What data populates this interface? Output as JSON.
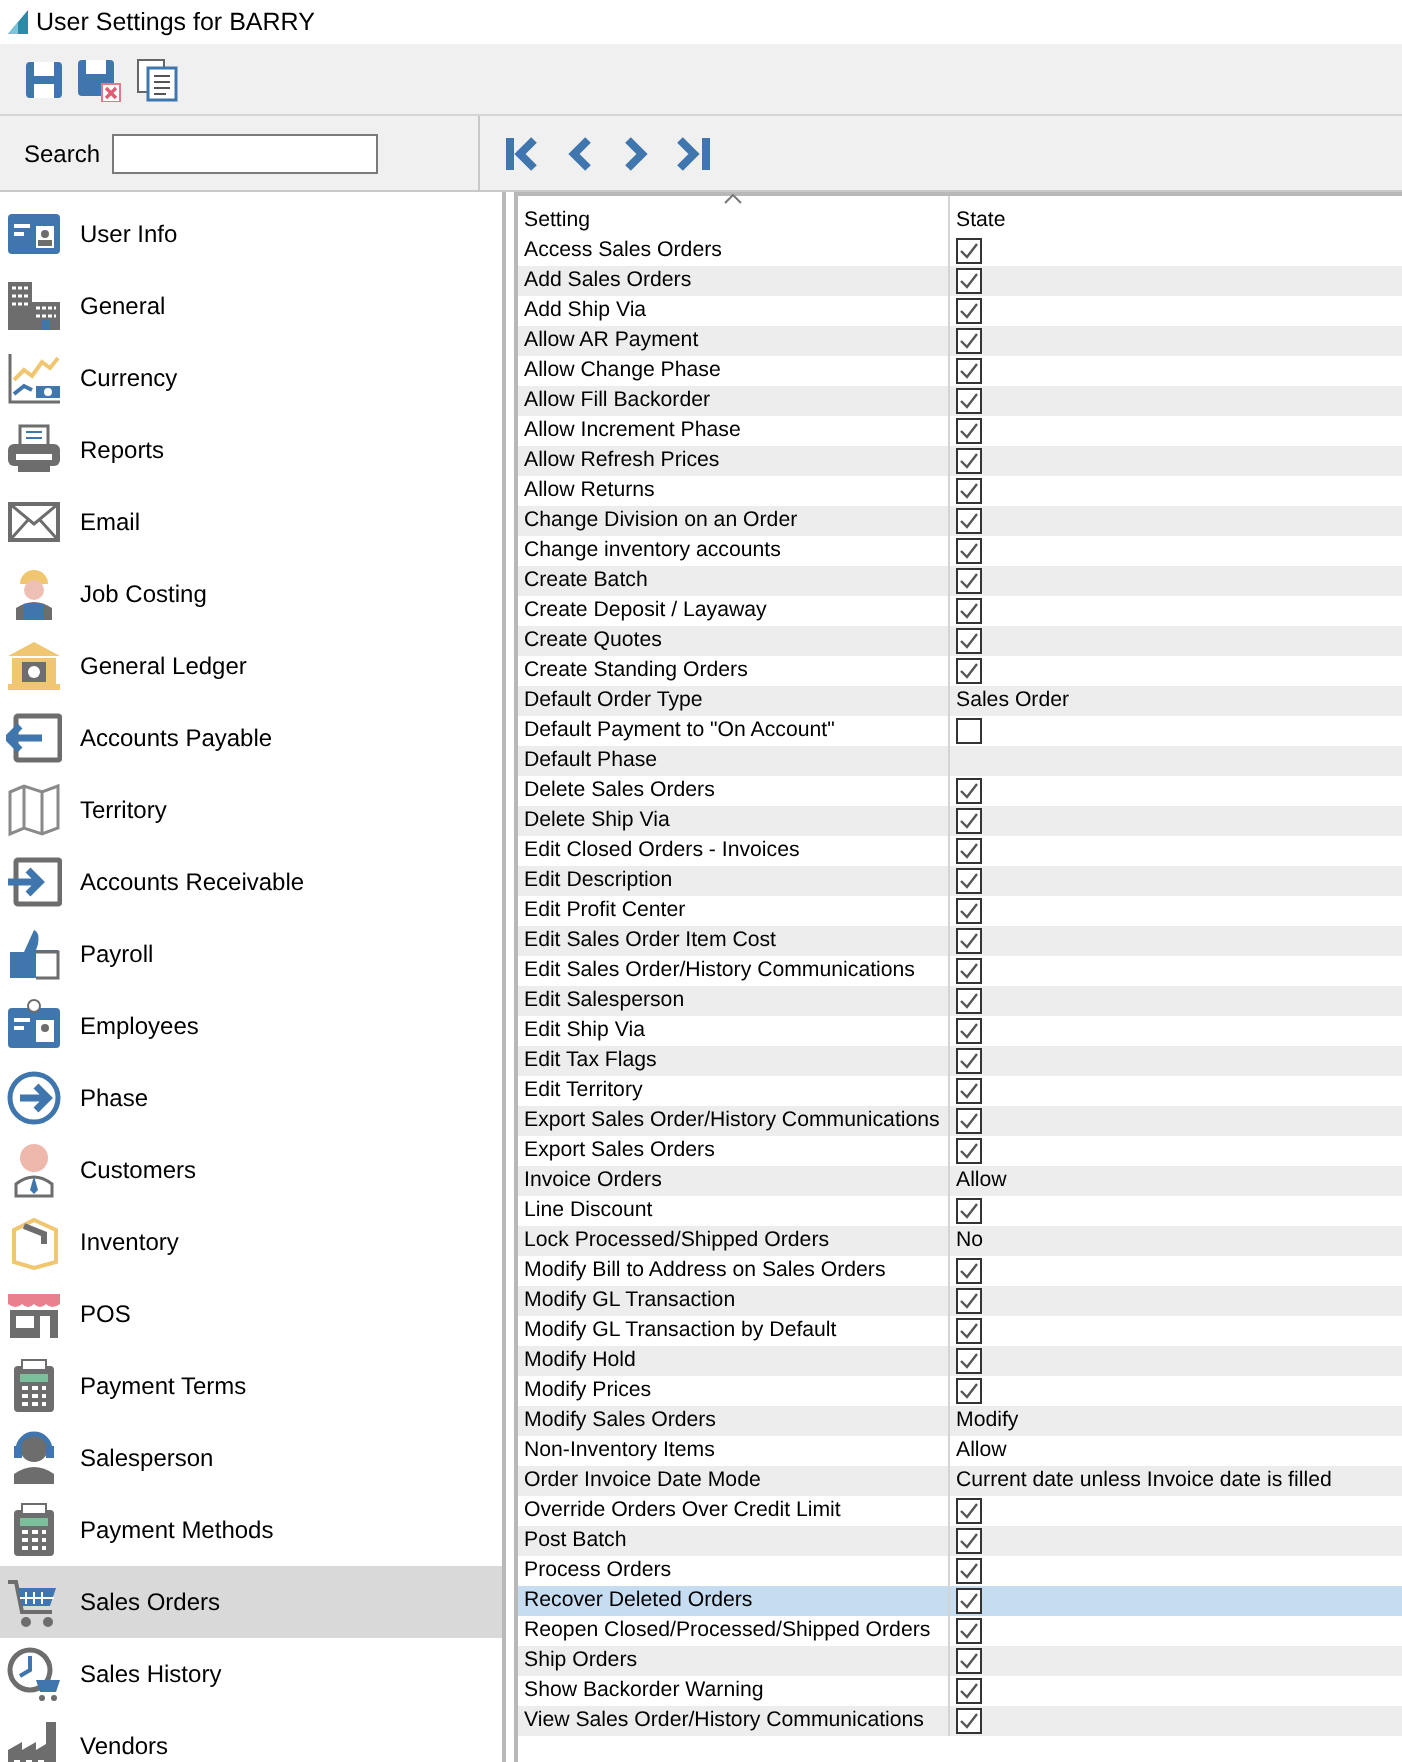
{
  "window": {
    "title": "User Settings for BARRY"
  },
  "search": {
    "label": "Search"
  },
  "sidebar": {
    "items": [
      {
        "label": "User Info",
        "selected": false
      },
      {
        "label": "General",
        "selected": false
      },
      {
        "label": "Currency",
        "selected": false
      },
      {
        "label": "Reports",
        "selected": false
      },
      {
        "label": "Email",
        "selected": false
      },
      {
        "label": "Job Costing",
        "selected": false
      },
      {
        "label": "General Ledger",
        "selected": false
      },
      {
        "label": "Accounts Payable",
        "selected": false
      },
      {
        "label": "Territory",
        "selected": false
      },
      {
        "label": "Accounts Receivable",
        "selected": false
      },
      {
        "label": "Payroll",
        "selected": false
      },
      {
        "label": "Employees",
        "selected": false
      },
      {
        "label": "Phase",
        "selected": false
      },
      {
        "label": "Customers",
        "selected": false
      },
      {
        "label": "Inventory",
        "selected": false
      },
      {
        "label": "POS",
        "selected": false
      },
      {
        "label": "Payment Terms",
        "selected": false
      },
      {
        "label": "Salesperson",
        "selected": false
      },
      {
        "label": "Payment Methods",
        "selected": false
      },
      {
        "label": "Sales Orders",
        "selected": true
      },
      {
        "label": "Sales History",
        "selected": false
      },
      {
        "label": "Vendors",
        "selected": false
      }
    ]
  },
  "table": {
    "columns": [
      "Setting",
      "State"
    ],
    "rows": [
      {
        "setting": "Access Sales Orders",
        "kind": "check",
        "checked": true,
        "selected": false
      },
      {
        "setting": "Add Sales Orders",
        "kind": "check",
        "checked": true,
        "selected": false
      },
      {
        "setting": "Add Ship Via",
        "kind": "check",
        "checked": true,
        "selected": false
      },
      {
        "setting": "Allow AR Payment",
        "kind": "check",
        "checked": true,
        "selected": false
      },
      {
        "setting": "Allow Change Phase",
        "kind": "check",
        "checked": true,
        "selected": false
      },
      {
        "setting": "Allow Fill Backorder",
        "kind": "check",
        "checked": true,
        "selected": false
      },
      {
        "setting": "Allow Increment Phase",
        "kind": "check",
        "checked": true,
        "selected": false
      },
      {
        "setting": "Allow Refresh Prices",
        "kind": "check",
        "checked": true,
        "selected": false
      },
      {
        "setting": "Allow Returns",
        "kind": "check",
        "checked": true,
        "selected": false
      },
      {
        "setting": "Change Division on an Order",
        "kind": "check",
        "checked": true,
        "selected": false
      },
      {
        "setting": "Change inventory accounts",
        "kind": "check",
        "checked": true,
        "selected": false
      },
      {
        "setting": "Create Batch",
        "kind": "check",
        "checked": true,
        "selected": false
      },
      {
        "setting": "Create Deposit / Layaway",
        "kind": "check",
        "checked": true,
        "selected": false
      },
      {
        "setting": "Create Quotes",
        "kind": "check",
        "checked": true,
        "selected": false
      },
      {
        "setting": "Create Standing Orders",
        "kind": "check",
        "checked": true,
        "selected": false
      },
      {
        "setting": "Default Order Type",
        "kind": "text",
        "value": "Sales Order",
        "selected": false
      },
      {
        "setting": "Default Payment to \"On Account\"",
        "kind": "check",
        "checked": false,
        "selected": false
      },
      {
        "setting": "Default Phase",
        "kind": "blank",
        "selected": false
      },
      {
        "setting": "Delete Sales Orders",
        "kind": "check",
        "checked": true,
        "selected": false
      },
      {
        "setting": "Delete Ship Via",
        "kind": "check",
        "checked": true,
        "selected": false
      },
      {
        "setting": "Edit Closed Orders - Invoices",
        "kind": "check",
        "checked": true,
        "selected": false
      },
      {
        "setting": "Edit Description",
        "kind": "check",
        "checked": true,
        "selected": false
      },
      {
        "setting": "Edit Profit Center",
        "kind": "check",
        "checked": true,
        "selected": false
      },
      {
        "setting": "Edit Sales Order Item Cost",
        "kind": "check",
        "checked": true,
        "selected": false
      },
      {
        "setting": "Edit Sales Order/History Communications",
        "kind": "check",
        "checked": true,
        "selected": false
      },
      {
        "setting": "Edit Salesperson",
        "kind": "check",
        "checked": true,
        "selected": false
      },
      {
        "setting": "Edit Ship Via",
        "kind": "check",
        "checked": true,
        "selected": false
      },
      {
        "setting": "Edit Tax Flags",
        "kind": "check",
        "checked": true,
        "selected": false
      },
      {
        "setting": "Edit Territory",
        "kind": "check",
        "checked": true,
        "selected": false
      },
      {
        "setting": "Export Sales Order/History Communications",
        "kind": "check",
        "checked": true,
        "selected": false
      },
      {
        "setting": "Export Sales Orders",
        "kind": "check",
        "checked": true,
        "selected": false
      },
      {
        "setting": "Invoice Orders",
        "kind": "text",
        "value": "Allow",
        "selected": false
      },
      {
        "setting": "Line Discount",
        "kind": "check",
        "checked": true,
        "selected": false
      },
      {
        "setting": "Lock Processed/Shipped Orders",
        "kind": "text",
        "value": "No",
        "selected": false
      },
      {
        "setting": "Modify Bill to Address on Sales Orders",
        "kind": "check",
        "checked": true,
        "selected": false
      },
      {
        "setting": "Modify GL Transaction",
        "kind": "check",
        "checked": true,
        "selected": false
      },
      {
        "setting": "Modify GL Transaction by Default",
        "kind": "check",
        "checked": true,
        "selected": false
      },
      {
        "setting": "Modify Hold",
        "kind": "check",
        "checked": true,
        "selected": false
      },
      {
        "setting": "Modify Prices",
        "kind": "check",
        "checked": true,
        "selected": false
      },
      {
        "setting": "Modify Sales Orders",
        "kind": "text",
        "value": "Modify",
        "selected": false
      },
      {
        "setting": "Non-Inventory Items",
        "kind": "text",
        "value": "Allow",
        "selected": false
      },
      {
        "setting": "Order Invoice Date Mode",
        "kind": "text",
        "value": "Current date unless Invoice date is filled",
        "selected": false
      },
      {
        "setting": "Override Orders Over Credit Limit",
        "kind": "check",
        "checked": true,
        "selected": false
      },
      {
        "setting": "Post Batch",
        "kind": "check",
        "checked": true,
        "selected": false
      },
      {
        "setting": "Process Orders",
        "kind": "check",
        "checked": true,
        "selected": false
      },
      {
        "setting": "Recover Deleted Orders",
        "kind": "check",
        "checked": true,
        "selected": true
      },
      {
        "setting": "Reopen Closed/Processed/Shipped Orders",
        "kind": "check",
        "checked": true,
        "selected": false
      },
      {
        "setting": "Ship Orders",
        "kind": "check",
        "checked": true,
        "selected": false
      },
      {
        "setting": "Show Backorder Warning",
        "kind": "check",
        "checked": true,
        "selected": false
      },
      {
        "setting": "View Sales Order/History Communications",
        "kind": "check",
        "checked": true,
        "selected": false
      }
    ]
  }
}
